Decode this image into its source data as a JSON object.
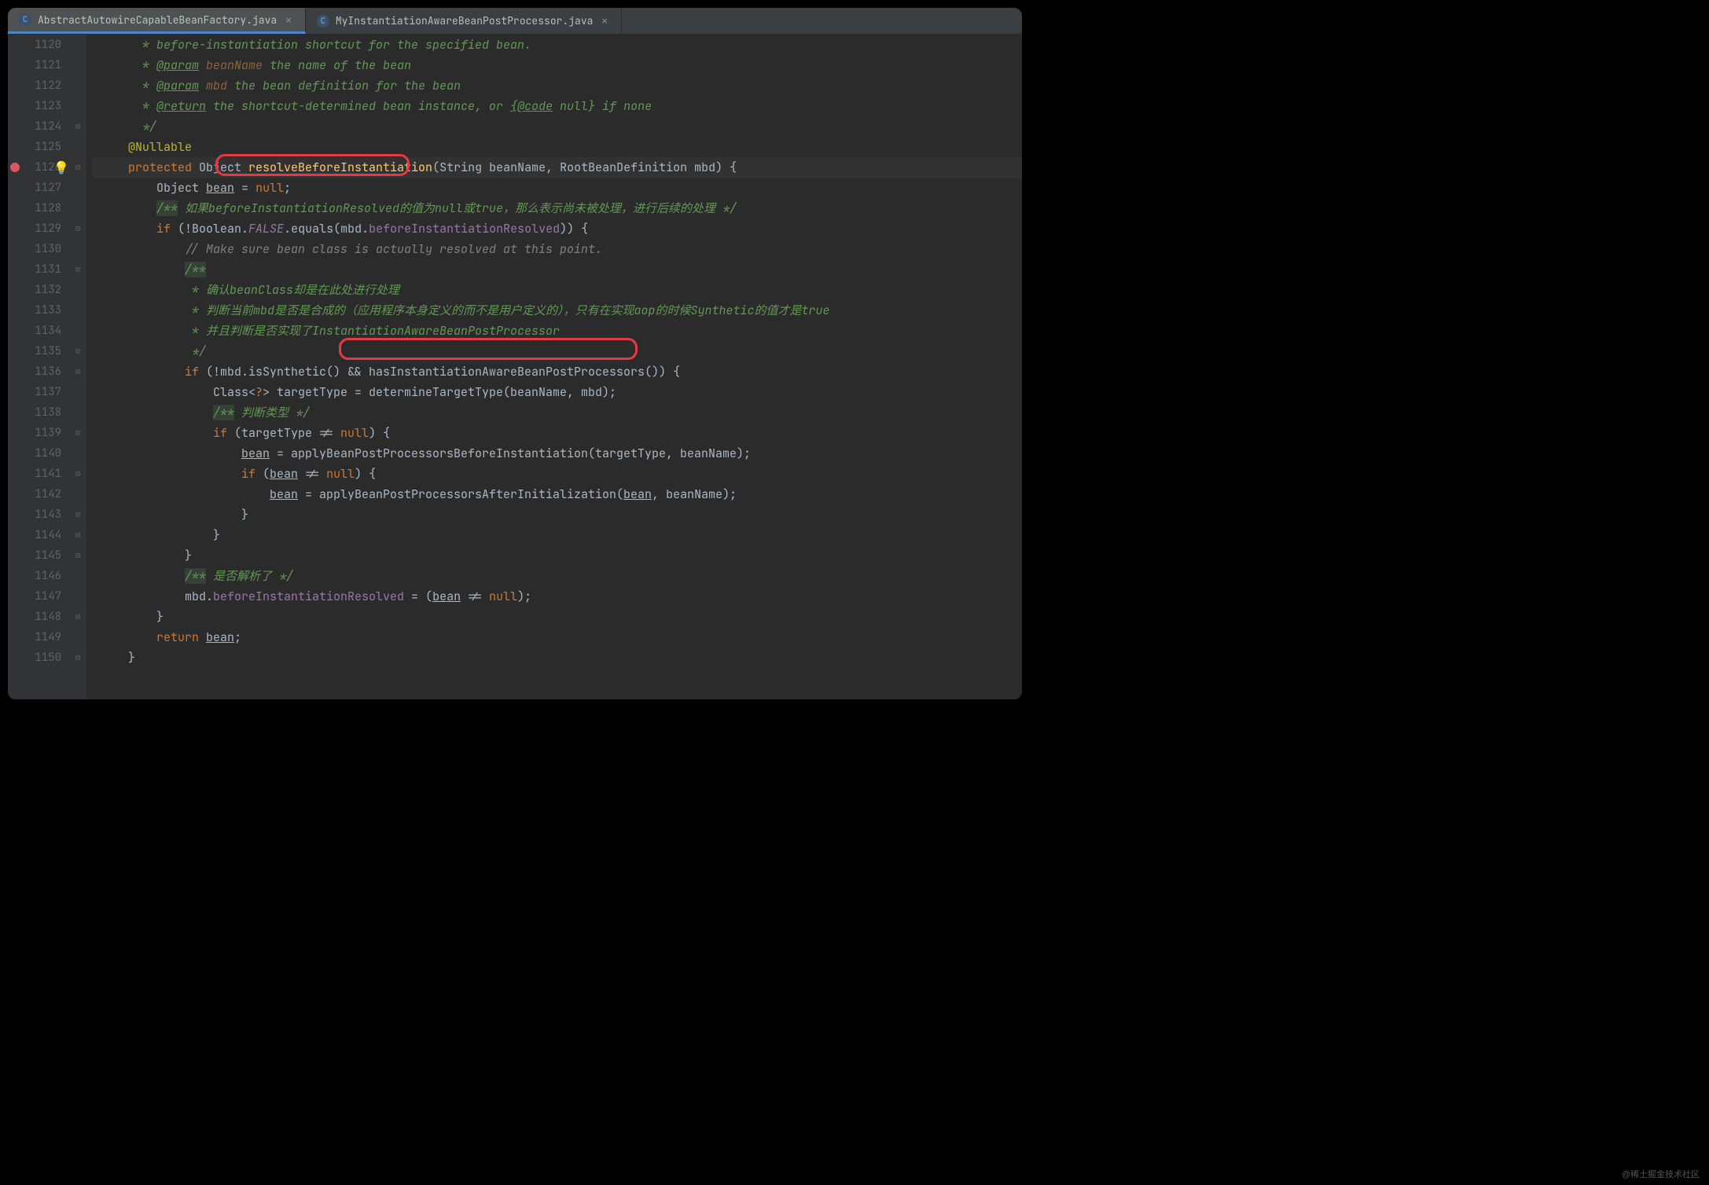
{
  "tabs": [
    {
      "name": "AbstractAutowireCapableBeanFactory.java",
      "active": true
    },
    {
      "name": "MyInstantiationAwareBeanPostProcessor.java",
      "active": false
    }
  ],
  "lineStart": 1120,
  "lineEnd": 1150,
  "currentLine": 1126,
  "foldMarkers": {
    "1124": "⊟",
    "1126": "⊟",
    "1129": "⊟",
    "1131": "⊟",
    "1135": "⊟",
    "1136": "⊟",
    "1139": "⊟",
    "1141": "⊟",
    "1143": "⊟",
    "1144": "⊟",
    "1145": "⊟",
    "1148": "⊟",
    "1150": "⊟"
  },
  "code": {
    "l1120": " * before-instantiation shortcut for the specified bean.",
    "l1121a": " * ",
    "l1121b": "@param",
    "l1121c": " beanName",
    "l1121d": " the name of the bean",
    "l1122a": " * ",
    "l1122b": "@param",
    "l1122c": " mbd",
    "l1122d": " the bean definition for the bean",
    "l1123a": " * ",
    "l1123b": "@return",
    "l1123c": " the shortcut-determined bean instance, or ",
    "l1123d": "{@code",
    "l1123e": " null}",
    "l1123f": " if none",
    "l1124": " */",
    "l1125": "@Nullable",
    "l1126a": "protected",
    "l1126b": " Object ",
    "l1126c": "resolveBeforeInstantiation",
    "l1126d": "(String beanName, RootBeanDefinition mbd) {",
    "l1127a": "Object ",
    "l1127b": "bean",
    "l1127c": " = ",
    "l1127d": "null",
    "l1127e": ";",
    "l1128a": "/**",
    "l1128b": " 如果beforeInstantiationResolved的值为null或true，那么表示尚未被处理，进行后续的处理 */",
    "l1129a": "if",
    "l1129b": " (!Boolean.",
    "l1129c": "FALSE",
    "l1129d": ".equals(mbd.",
    "l1129e": "beforeInstantiationResolved",
    "l1129f": ")) {",
    "l1130": "// Make sure bean class is actually resolved at this point.",
    "l1131": "/**",
    "l1132": " * 确认beanClass却是在此处进行处理",
    "l1133": " * 判断当前mbd是否是合成的（应用程序本身定义的而不是用户定义的），只有在实现aop的时候Synthetic的值才是true",
    "l1134": " * 并且判断是否实现了InstantiationAwareBeanPostProcessor",
    "l1135": " */",
    "l1136a": "if",
    "l1136b": " (!mbd.isSynthetic() && ",
    "l1136c": "hasInstantiationAwareBeanPostProcessors",
    "l1136d": "()) {",
    "l1137a": "Class<",
    "l1137b": "?",
    "l1137c": "> targetType = determineTargetType(beanName, mbd);",
    "l1138a": "/**",
    "l1138b": " 判断类型 */",
    "l1139a": "if",
    "l1139b": " (targetType != ",
    "l1139c": "null",
    "l1139d": ") {",
    "l1140a": "bean",
    "l1140b": " = applyBeanPostProcessorsBeforeInstantiation(targetType, beanName);",
    "l1141a": "if",
    "l1141b": " (",
    "l1141c": "bean",
    "l1141d": " != ",
    "l1141e": "null",
    "l1141f": ") {",
    "l1142a": "bean",
    "l1142b": " = applyBeanPostProcessorsAfterInitialization(",
    "l1142c": "bean",
    "l1142d": ", beanName);",
    "l1143": "}",
    "l1144": "}",
    "l1145": "}",
    "l1146a": "/**",
    "l1146b": " 是否解析了 */",
    "l1147a": "mbd.",
    "l1147b": "beforeInstantiationResolved",
    "l1147c": " = (",
    "l1147d": "bean",
    "l1147e": " != ",
    "l1147f": "null",
    "l1147g": ");",
    "l1148": "}",
    "l1149a": "return",
    "l1149b": " ",
    "l1149c": "bean",
    "l1149d": ";",
    "l1150": "}"
  },
  "indent": {
    "base": "    ",
    "d0": "",
    "d1": "    ",
    "d2": "        ",
    "d3": "            ",
    "d4": "                ",
    "d5": "                    "
  },
  "watermark": "@稀土掘金技术社区"
}
